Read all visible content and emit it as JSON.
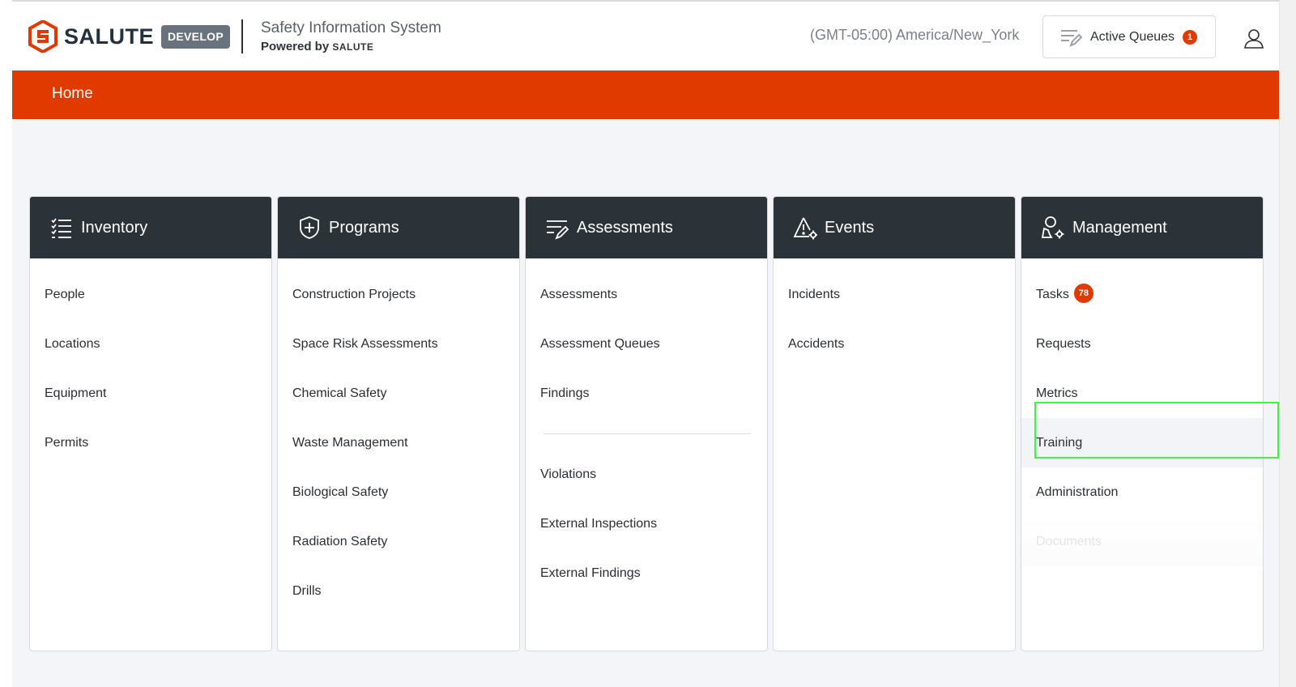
{
  "header": {
    "logo_text": "SALUTE",
    "env_badge": "DEVELOP",
    "system_title": "Safety Information System",
    "powered_by": "Powered by",
    "powered_brand": "SALUTE",
    "timezone": "(GMT-05:00) America/New_York",
    "active_queues_label": "Active Queues",
    "active_queues_count": "1"
  },
  "nav": {
    "home": "Home"
  },
  "cards": {
    "inventory": {
      "title": "Inventory",
      "items": [
        "People",
        "Locations",
        "Equipment",
        "Permits"
      ]
    },
    "programs": {
      "title": "Programs",
      "items": [
        "Construction Projects",
        "Space Risk Assessments",
        "Chemical Safety",
        "Waste Management",
        "Biological Safety",
        "Radiation Safety",
        "Drills"
      ]
    },
    "assessments": {
      "title": "Assessments",
      "items_top": [
        "Assessments",
        "Assessment Queues",
        "Findings"
      ],
      "items_bottom": [
        "Violations",
        "External Inspections",
        "External Findings"
      ]
    },
    "events": {
      "title": "Events",
      "items": [
        "Incidents",
        "Accidents"
      ]
    },
    "management": {
      "title": "Management",
      "tasks": "Tasks",
      "tasks_count": "78",
      "requests": "Requests",
      "metrics": "Metrics",
      "training": "Training",
      "administration": "Administration",
      "documents": "Documents"
    }
  },
  "colors": {
    "accent": "#e03a00",
    "card_header": "#2c3338",
    "highlight": "#3cf53c"
  }
}
